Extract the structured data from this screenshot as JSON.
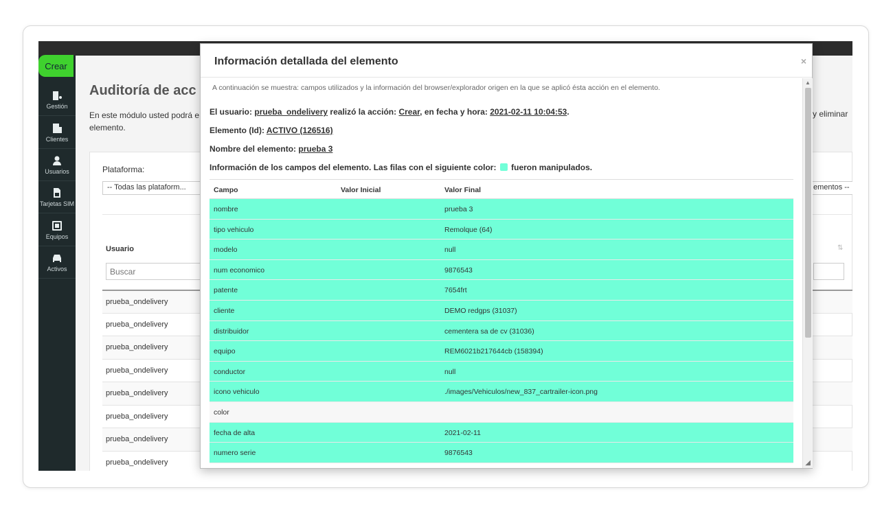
{
  "sidebar": {
    "create_label": "Crear",
    "items": [
      {
        "label": "Gestión",
        "icon": "building-gear-icon"
      },
      {
        "label": "Clientes",
        "icon": "building-icon"
      },
      {
        "label": "Usuarios",
        "icon": "user-icon"
      },
      {
        "label": "Tarjetas SIM",
        "icon": "sim-card-icon"
      },
      {
        "label": "Equipos",
        "icon": "device-icon"
      },
      {
        "label": "Activos",
        "icon": "car-icon"
      }
    ]
  },
  "page": {
    "title": "Auditoría de acc",
    "description": "En este módulo usted podrá e elemento.",
    "description_right": "y eliminar",
    "platform_label": "Plataforma:",
    "platform_select": "-- Todas las plataform...",
    "elements_select": "ementos --",
    "user_column": "Usuario",
    "search_placeholder": "Buscar",
    "user_rows": [
      "prueba_ondelivery",
      "prueba_ondelivery",
      "prueba_ondelivery",
      "prueba_ondelivery",
      "prueba_ondelivery",
      "prueba_ondelivery",
      "prueba_ondelivery",
      "prueba_ondelivery"
    ]
  },
  "modal": {
    "title": "Información detallada del elemento",
    "close": "×",
    "intro": "A continuación se muestra: campos utilizados y la información del browser/explorador origen en la que se aplicó ésta acción en el elemento.",
    "user_prefix": "El usuario:",
    "user": "prueba_ondelivery",
    "action_prefix": "realizó la acción:",
    "action": "Crear",
    "date_prefix": ", en fecha y hora:",
    "datetime": "2021-02-11 10:04:53",
    "period": ".",
    "element_prefix": "Elemento (Id):",
    "element_id": "ACTIVO (126516)",
    "name_prefix": "Nombre del elemento:",
    "element_name": "prueba 3",
    "fields_info_prefix": "Información de los campos del elemento. Las filas con el siguiente color:",
    "fields_info_suffix": "fueron manipulados.",
    "highlight_color": "#71ffd8",
    "columns": [
      "Campo",
      "Valor Inicial",
      "Valor Final"
    ],
    "rows": [
      {
        "campo": "nombre",
        "inicial": "",
        "final": "prueba 3",
        "modified": true
      },
      {
        "campo": "tipo vehiculo",
        "inicial": "",
        "final": "Remolque (64)",
        "modified": true
      },
      {
        "campo": "modelo",
        "inicial": "",
        "final": "null",
        "modified": true
      },
      {
        "campo": "num economico",
        "inicial": "",
        "final": "9876543",
        "modified": true
      },
      {
        "campo": "patente",
        "inicial": "",
        "final": "7654frt",
        "modified": true
      },
      {
        "campo": "cliente",
        "inicial": "",
        "final": "DEMO redgps (31037)",
        "modified": true
      },
      {
        "campo": "distribuidor",
        "inicial": "",
        "final": "cementera sa de cv (31036)",
        "modified": true
      },
      {
        "campo": "equipo",
        "inicial": "",
        "final": "REM6021b217644cb (158394)",
        "modified": true
      },
      {
        "campo": "conductor",
        "inicial": "",
        "final": "null",
        "modified": true
      },
      {
        "campo": "icono vehiculo",
        "inicial": "",
        "final": "./images/Vehiculos/new_837_cartrailer-icon.png",
        "modified": true
      },
      {
        "campo": "color",
        "inicial": "",
        "final": "",
        "modified": false
      },
      {
        "campo": "fecha de alta",
        "inicial": "",
        "final": "2021-02-11",
        "modified": true
      },
      {
        "campo": "numero serie",
        "inicial": "",
        "final": "9876543",
        "modified": true
      }
    ]
  }
}
